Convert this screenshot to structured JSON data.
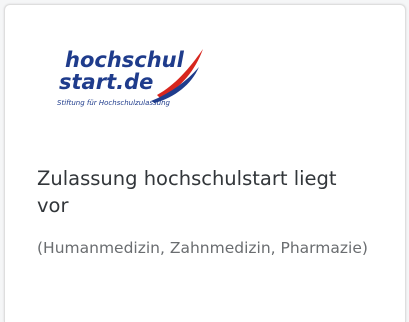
{
  "tile": {
    "logo": {
      "line1": "hochschul",
      "line2": "start.de",
      "tagline": "Stiftung für Hochschulzulassung",
      "colors": {
        "text_blue": "#1f3c8c",
        "swoosh_red": "#d7261e",
        "swoosh_blue": "#1f3c8c"
      }
    },
    "title": "Zulassung hochschulstart liegt vor",
    "subtitle": "(Humanmedizin, Zahnmedizin, Pharmazie)"
  }
}
